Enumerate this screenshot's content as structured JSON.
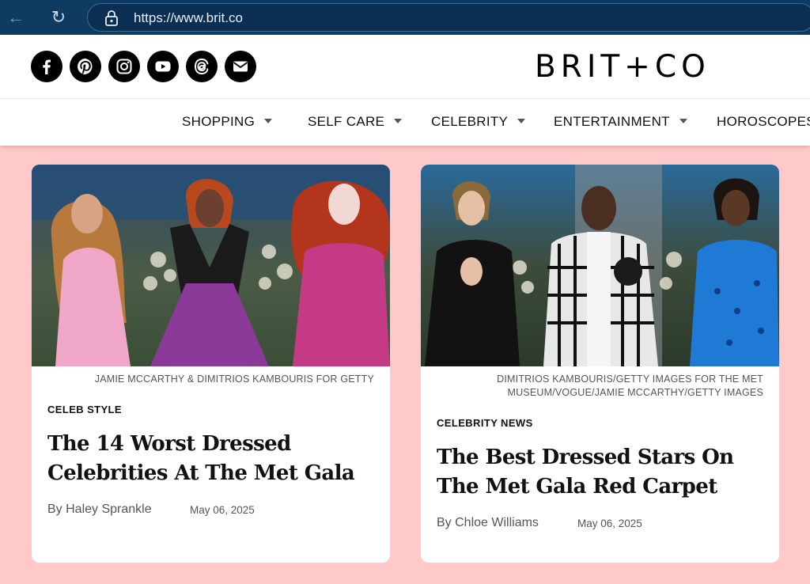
{
  "browser": {
    "url": "https://www.brit.co"
  },
  "header": {
    "logo": "BRIT+CO",
    "social": [
      "facebook-icon",
      "pinterest-icon",
      "instagram-icon",
      "youtube-icon",
      "threads-icon",
      "email-icon"
    ]
  },
  "menu": {
    "items": [
      {
        "label": "SHOPPING",
        "has_dropdown": true
      },
      {
        "label": "SELF CARE",
        "has_dropdown": true
      },
      {
        "label": "CELEBRITY",
        "has_dropdown": true
      },
      {
        "label": "ENTERTAINMENT",
        "has_dropdown": true
      },
      {
        "label": "HOROSCOPES",
        "has_dropdown": false
      }
    ]
  },
  "articles": [
    {
      "credit": "JAMIE MCCARTHY & DIMITRIOS KAMBOURIS FOR GETTY",
      "category": "CELEB STYLE",
      "headline": "The 14 Worst Dressed Celebrities At The Met Gala",
      "author": "By Haley Sprankle",
      "date": "May 06, 2025"
    },
    {
      "credit": "DIMITRIOS KAMBOURIS/GETTY IMAGES FOR THE MET MUSEUM/VOGUE/JAMIE MCCARTHY/GETTY IMAGES",
      "category": "CELEBRITY NEWS",
      "headline": "The Best Dressed Stars On The Met Gala Red Carpet",
      "author": "By Chloe Williams",
      "date": "May 06, 2025"
    }
  ],
  "colors": {
    "page_background": "#ffc9c9",
    "browser_bar": "#0f3b63",
    "card_background": "#ffffff"
  }
}
